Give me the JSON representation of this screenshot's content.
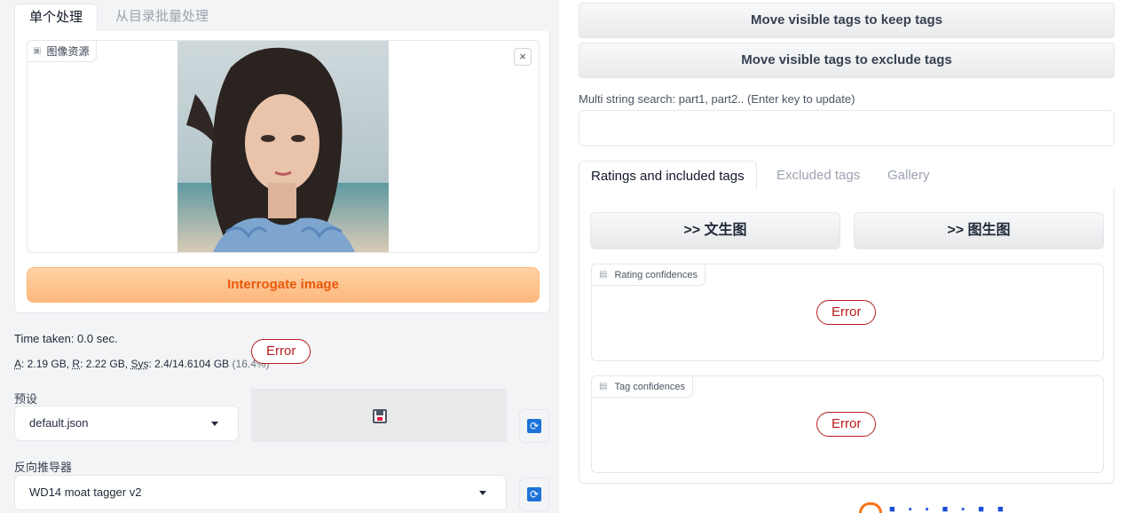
{
  "left": {
    "tabs": [
      {
        "label": "单个处理",
        "active": true
      },
      {
        "label": "从目录批量处理",
        "active": false
      }
    ],
    "image_source": {
      "label": "图像资源",
      "close_glyph": "×"
    },
    "interrogate_button": "Interrogate image",
    "time_taken": "Time taken: 0.0 sec.",
    "memory": {
      "a_key": "A",
      "a_value": ": 2.19 GB, ",
      "r_key": "R",
      "r_value": ": 2.22 GB, ",
      "sys_key": "Sys",
      "sys_value": ": 2.4/14.6104 GB ",
      "sys_pct": "(16.4%)"
    },
    "error_label": "Error",
    "preset": {
      "label": "预设",
      "value": "default.json"
    },
    "interrogator": {
      "label": "反向推导器",
      "value": "WD14 moat tagger v2"
    },
    "refresh_glyph": "⟳"
  },
  "right": {
    "buttons": {
      "move_keep": "Move visible tags to keep tags",
      "move_exclude": "Move visible tags to exclude tags"
    },
    "search": {
      "label": "Multi string search: part1, part2.. (Enter key to update)",
      "value": ""
    },
    "tabs": [
      {
        "label": "Ratings and included tags",
        "active": true
      },
      {
        "label": "Excluded tags",
        "active": false
      },
      {
        "label": "Gallery",
        "active": false
      }
    ],
    "send_txt2img": ">> 文生图",
    "send_img2img": ">> 图生图",
    "rating_confidences": {
      "label": "Rating confidences",
      "status": "Error"
    },
    "tag_confidences": {
      "label": "Tag confidences",
      "status": "Error"
    }
  },
  "colors": {
    "accent_orange": "#ea580c",
    "error_red": "#b91c1c",
    "refresh_blue": "#1d72d8"
  }
}
